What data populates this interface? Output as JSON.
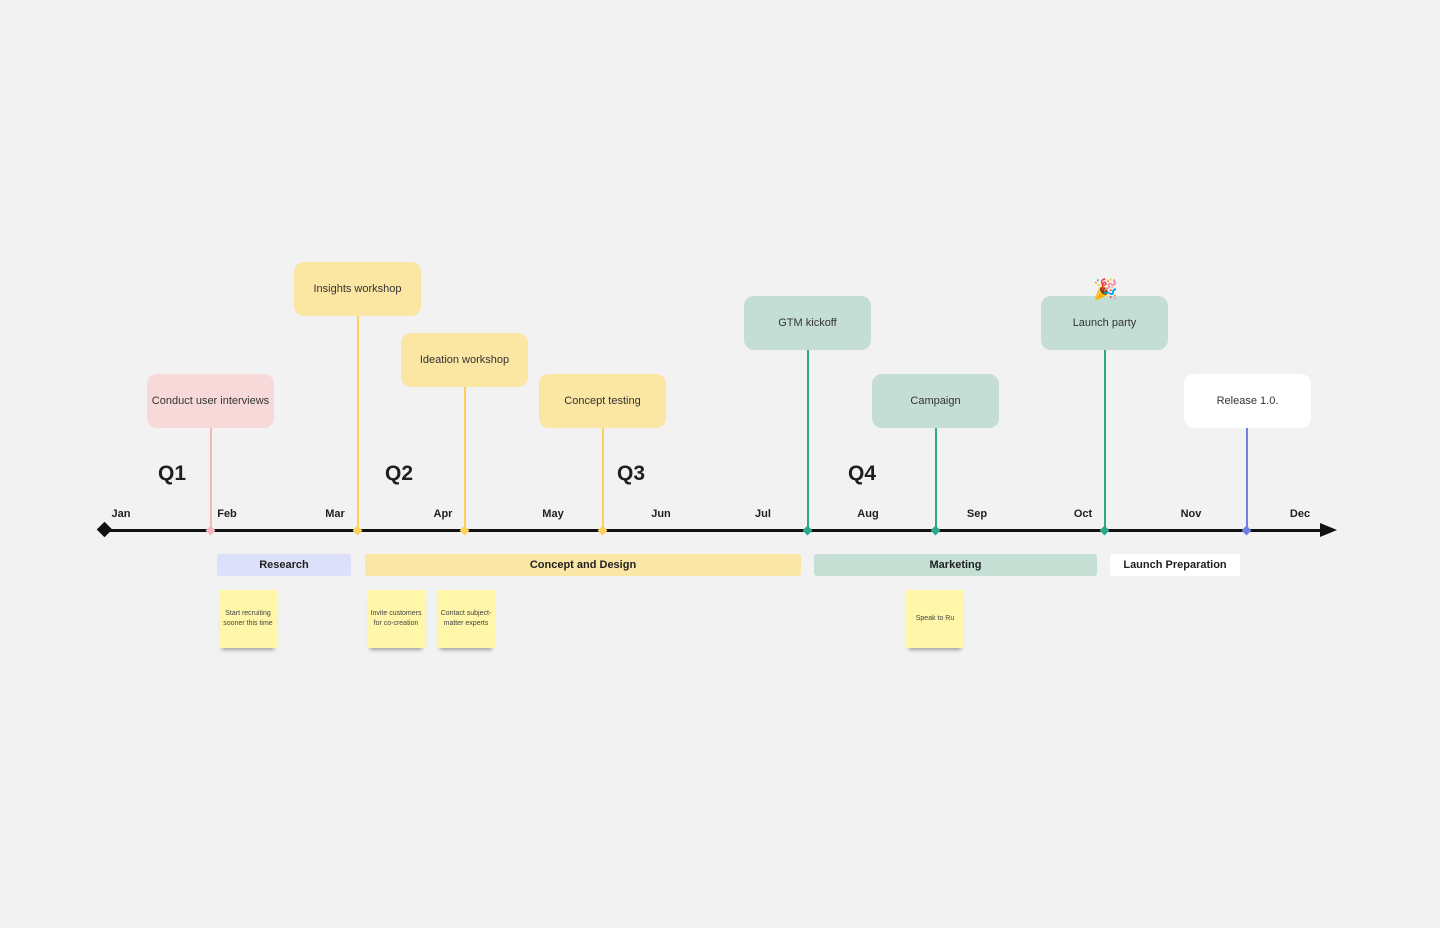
{
  "milestones": [
    {
      "label": "Conduct user interviews",
      "color": "#f8d9da",
      "line_color": "#f5b7bb"
    },
    {
      "label": "Insights workshop",
      "color": "#fbe6a3",
      "line_color": "#fdd15b"
    },
    {
      "label": "Ideation workshop",
      "color": "#fbe6a3",
      "line_color": "#fdd15b"
    },
    {
      "label": "Concept testing",
      "color": "#fbe6a3",
      "line_color": "#fdd15b"
    },
    {
      "label": "GTM kickoff",
      "color": "#c4ded5",
      "line_color": "#2fa88a"
    },
    {
      "label": "Campaign",
      "color": "#c4ded5",
      "line_color": "#2fa88a"
    },
    {
      "label": "Launch party",
      "color": "#c4ded5",
      "line_color": "#2fa88a",
      "icon": "party-popper-icon"
    },
    {
      "label": "Release 1.0.",
      "color": "#ffffff",
      "line_color": "#6f7fe6"
    }
  ],
  "quarters": [
    "Q1",
    "Q2",
    "Q3",
    "Q4"
  ],
  "months": [
    "Jan",
    "Feb",
    "Mar",
    "Apr",
    "May",
    "Jun",
    "Jul",
    "Aug",
    "Sep",
    "Oct",
    "Nov",
    "Dec"
  ],
  "phases": [
    {
      "label": "Research",
      "color": "#dde0fa"
    },
    {
      "label": "Concept and Design",
      "color": "#fae7a6"
    },
    {
      "label": "Marketing",
      "color": "#c5dfd5"
    },
    {
      "label": "Launch Preparation",
      "color": "#ffffff"
    }
  ],
  "stickies": [
    "Start recruiting sooner this time",
    "Invite customers for co-creation",
    "Contact subject-matter experts",
    "Speak to Ru"
  ]
}
